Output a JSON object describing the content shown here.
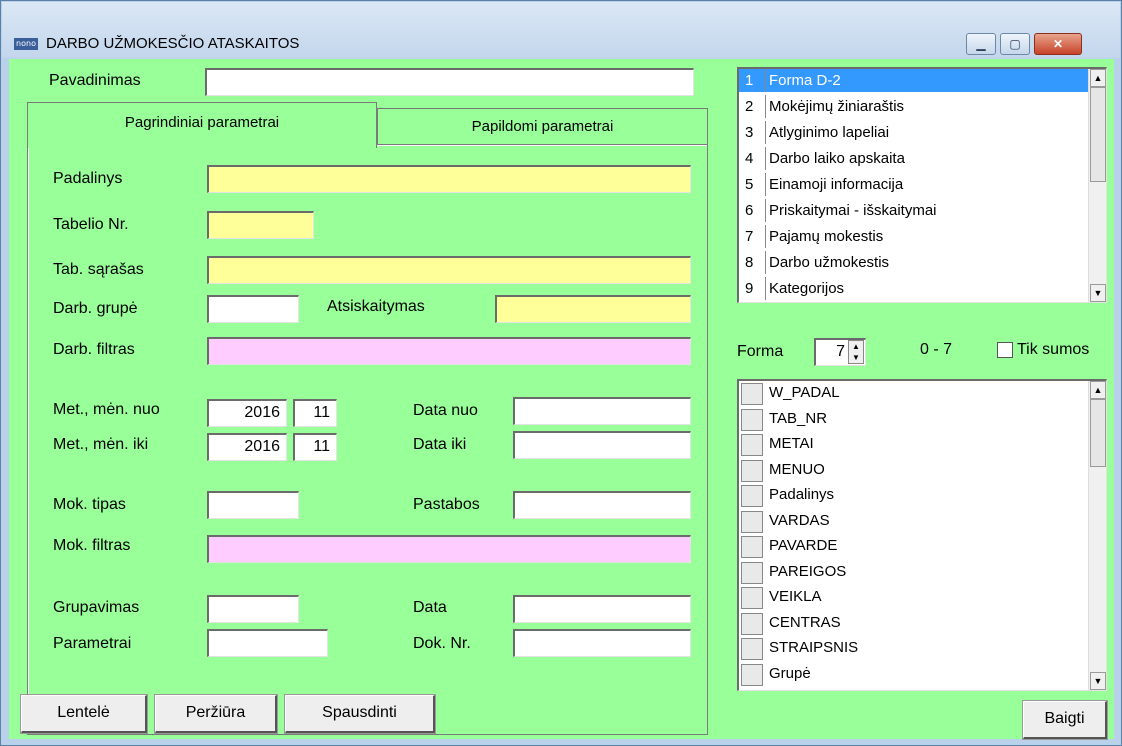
{
  "window": {
    "icon_text": "nono",
    "title": "DARBO UŽMOKESČIO ATASKAITOS",
    "min_glyph": "▁",
    "max_glyph": "▢",
    "close_glyph": "✕"
  },
  "form": {
    "pavadinimas_label": "Pavadinimas",
    "pavadinimas_value": "",
    "tabs": [
      "Pagrindiniai parametrai",
      "Papildomi parametrai"
    ],
    "padalinys_label": "Padalinys",
    "tabelio_label": "Tabelio Nr.",
    "tab_sarasas_label": "Tab. sąrašas",
    "darb_grupe_label": "Darb. grupė",
    "atsiskaitymas_label": "Atsiskaitymas",
    "darb_filtras_label": "Darb. filtras",
    "met_men_nuo_label": "Met., mėn. nuo",
    "met_men_iki_label": "Met., mėn. iki",
    "year_from": "2016",
    "month_from": "11",
    "year_to": "2016",
    "month_to": "11",
    "data_nuo_label": "Data nuo",
    "data_iki_label": "Data iki",
    "mok_tipas_label": "Mok. tipas",
    "pastabos_label": "Pastabos",
    "mok_filtras_label": "Mok. filtras",
    "grupavimas_label": "Grupavimas",
    "data_label": "Data",
    "parametrai_label": "Parametrai",
    "dok_nr_label": "Dok. Nr."
  },
  "reports": [
    {
      "num": "1",
      "name": "Forma D-2"
    },
    {
      "num": "2",
      "name": "Mokėjimų žiniaraštis"
    },
    {
      "num": "3",
      "name": "Atlyginimo lapeliai"
    },
    {
      "num": "4",
      "name": "Darbo laiko apskaita"
    },
    {
      "num": "5",
      "name": "Einamoji informacija"
    },
    {
      "num": "6",
      "name": "Priskaitymai - išskaitymai"
    },
    {
      "num": "7",
      "name": "Pajamų mokestis"
    },
    {
      "num": "8",
      "name": "Darbo užmokestis"
    },
    {
      "num": "9",
      "name": "Kategorijos"
    }
  ],
  "forma": {
    "label": "Forma",
    "value": "7",
    "range": "0 - 7",
    "tik_sumos_label": "Tik sumos"
  },
  "fields": [
    "W_PADAL",
    "TAB_NR",
    "METAI",
    "MENUO",
    "Padalinys",
    "VARDAS",
    "PAVARDE",
    "PAREIGOS",
    "VEIKLA",
    "CENTRAS",
    "STRAIPSNIS",
    "Grupė"
  ],
  "buttons": {
    "lentele": "Lentelė",
    "perziura": "Peržiūra",
    "spausdinti": "Spausdinti",
    "baigti": "Baigti"
  },
  "colors": {
    "form_bg": "#99ff99",
    "required_field": "#ffff99",
    "filter_field": "#ffccff",
    "selection": "#3399ff"
  }
}
